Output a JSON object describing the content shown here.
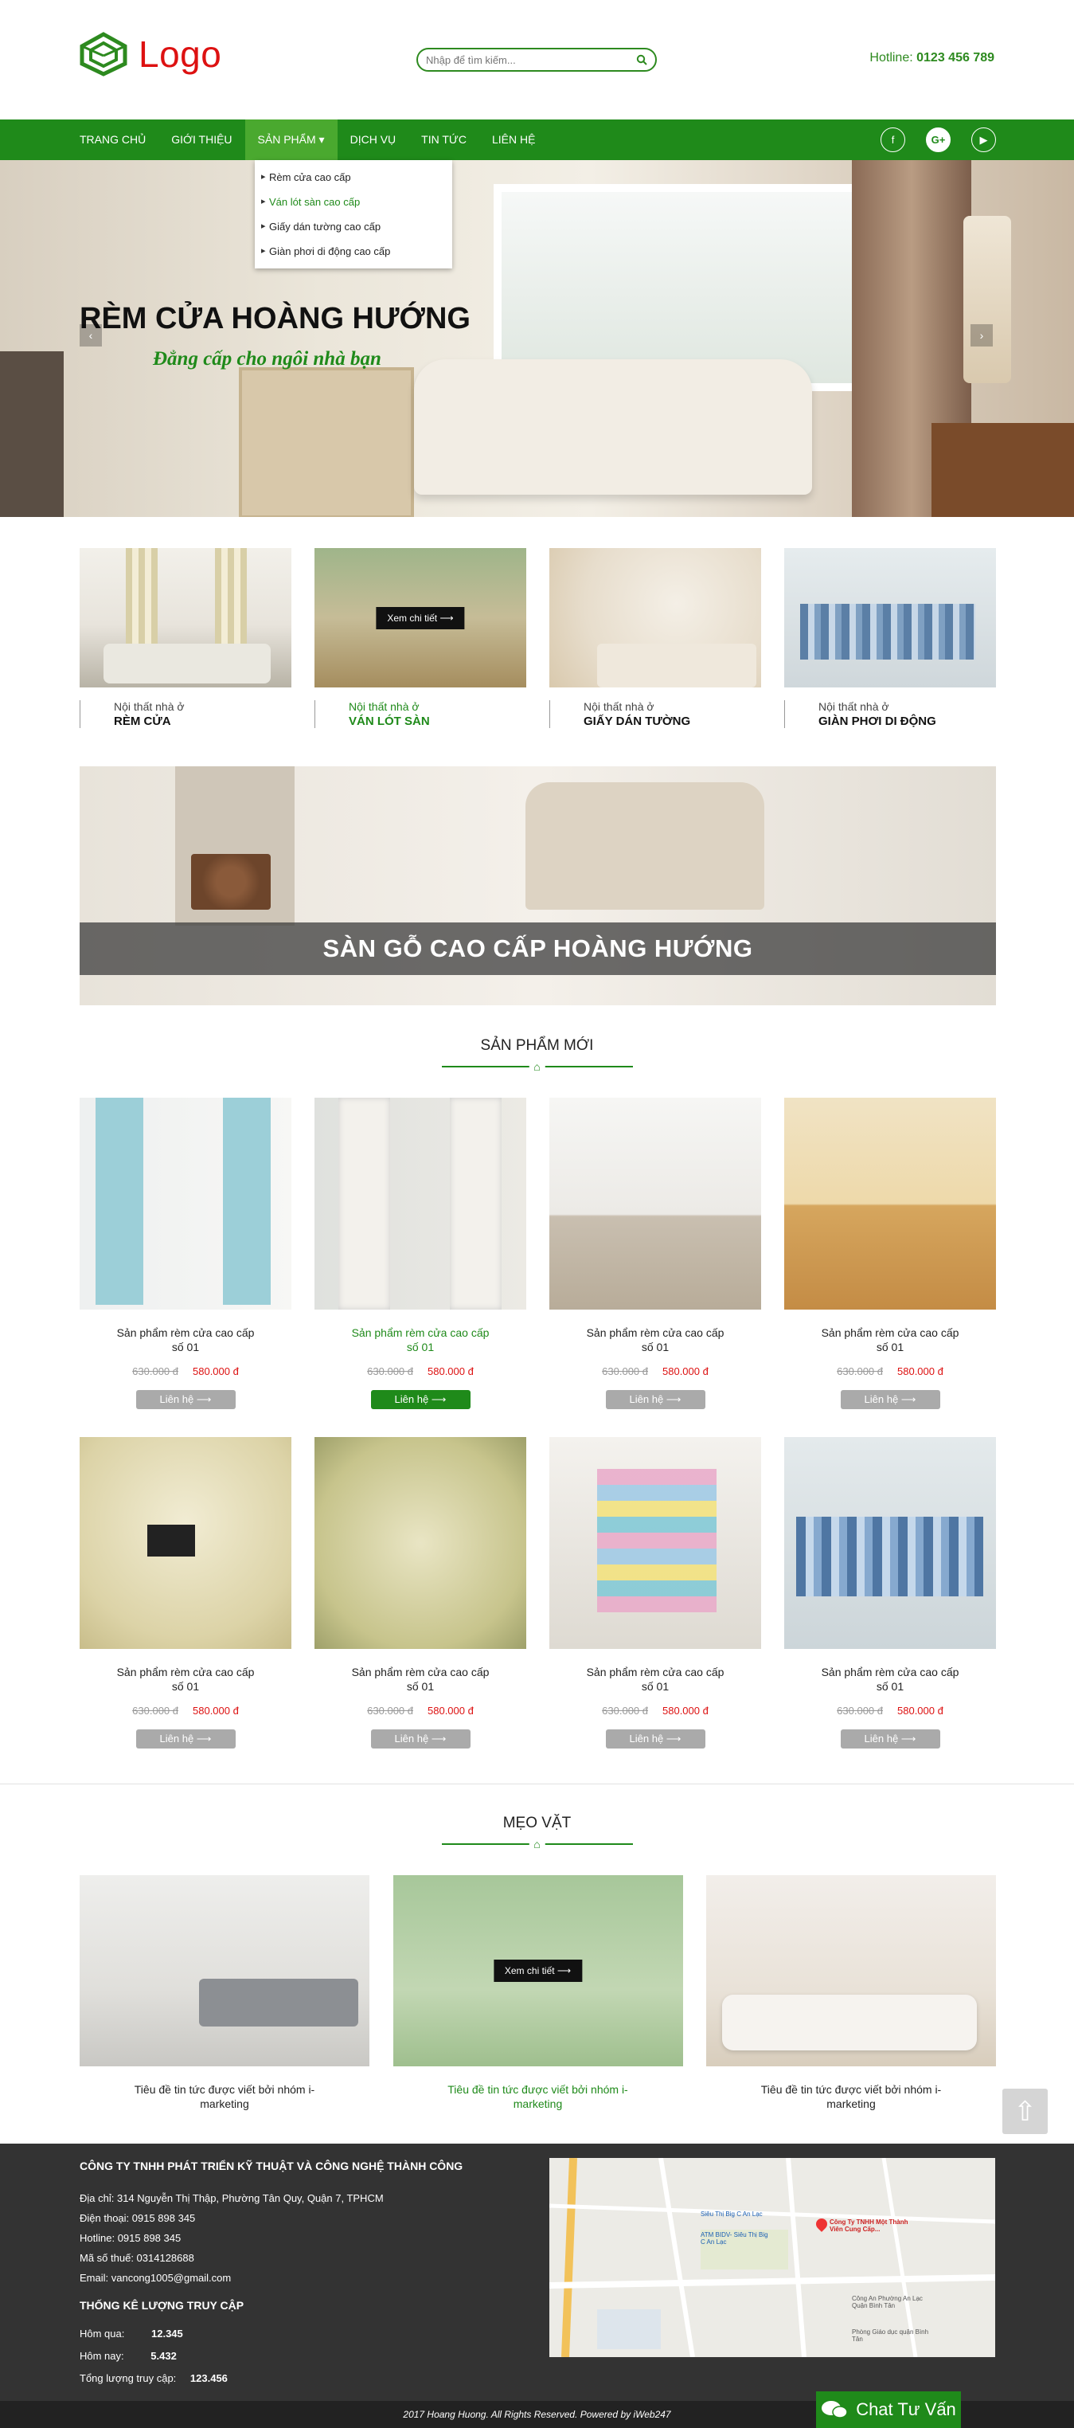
{
  "header": {
    "logo_text": "Logo",
    "search_placeholder": "Nhập để tìm kiếm...",
    "hotline_label": "Hotline:",
    "hotline_number": "0123 456 789"
  },
  "nav": {
    "items": [
      "TRANG CHỦ",
      "GIỚI THIỆU",
      "SẢN PHẨM ▾",
      "DỊCH VỤ",
      "TIN TỨC",
      "LIÊN HỆ"
    ],
    "socials": [
      "f",
      "G+",
      "▶"
    ],
    "dropdown": [
      "Rèm cửa cao cấp",
      "Ván lót sàn cao cấp",
      "Giấy dán tường cao cấp",
      "Giàn phơi di động cao cấp"
    ]
  },
  "slider": {
    "title": "RÈM CỬA HOÀNG HƯỚNG",
    "subtitle": "Đẳng cấp cho ngôi nhà bạn",
    "prev": "‹",
    "next": "›"
  },
  "categories": [
    {
      "small": "Nội thất nhà ở",
      "big": "RÈM CỬA"
    },
    {
      "small": "Nội thất nhà ở",
      "big": "VÁN LÓT SÀN",
      "overlay": "Xem chi tiết ⟶"
    },
    {
      "small": "Nội thất nhà ở",
      "big": "GIẤY DÁN TƯỜNG"
    },
    {
      "small": "Nội thất nhà ở",
      "big": "GIÀN PHƠI DI ĐỘNG"
    }
  ],
  "banner": {
    "title": "SÀN GỖ CAO CẤP HOÀNG HƯỚNG"
  },
  "new_products": {
    "title": "SẢN PHẨM MỚI",
    "row1": [
      {
        "name": "Sản phẩm rèm cửa cao cấp số 01",
        "old": "630.000 đ",
        "new": "580.000 đ",
        "btn": "Liên hệ ⟶"
      },
      {
        "name": "Sản phẩm rèm cửa cao cấp số 01",
        "old": "630.000 đ",
        "new": "580.000 đ",
        "btn": "Liên hệ ⟶"
      },
      {
        "name": "Sản phẩm rèm cửa cao cấp số 01",
        "old": "630.000 đ",
        "new": "580.000 đ",
        "btn": "Liên hệ ⟶"
      },
      {
        "name": "Sản phẩm rèm cửa cao cấp số 01",
        "old": "630.000 đ",
        "new": "580.000 đ",
        "btn": "Liên hệ ⟶"
      }
    ],
    "row2": [
      {
        "name": "Sản phẩm rèm cửa cao cấp số 01",
        "old": "630.000 đ",
        "new": "580.000 đ",
        "btn": "Liên hệ ⟶"
      },
      {
        "name": "Sản phẩm rèm cửa cao cấp số 01",
        "old": "630.000 đ",
        "new": "580.000 đ",
        "btn": "Liên hệ ⟶"
      },
      {
        "name": "Sản phẩm rèm cửa cao cấp số 01",
        "old": "630.000 đ",
        "new": "580.000 đ",
        "btn": "Liên hệ ⟶"
      },
      {
        "name": "Sản phẩm rèm cửa cao cấp số 01",
        "old": "630.000 đ",
        "new": "580.000 đ",
        "btn": "Liên hệ ⟶"
      }
    ]
  },
  "tips": {
    "title": "MẸO VẶT",
    "items": [
      {
        "title": "Tiêu đề tin tức được viết bởi nhóm i-marketing"
      },
      {
        "title": "Tiêu đề tin tức được viết bởi nhóm i-marketing",
        "overlay": "Xem chi tiết ⟶"
      },
      {
        "title": "Tiêu đề tin tức được viết bởi nhóm i-marketing"
      }
    ]
  },
  "footer": {
    "company": "CÔNG TY TNHH PHÁT TRIỂN KỸ THUẬT VÀ CÔNG NGHỆ THÀNH CÔNG",
    "address": "Địa chỉ: 314 Nguyễn Thị Thập, Phường Tân Quy, Quận 7, TPHCM",
    "phone": "Điện thoại: 0915 898 345",
    "hotline": "Hotline: 0915 898 345",
    "tax": "Mã số thuế: 0314128688",
    "email": "Email: vancong1005@gmail.com",
    "stats_title": "THỐNG KÊ LƯỢNG TRUY CẬP",
    "yesterday_label": "Hôm qua:",
    "yesterday": "12.345",
    "today_label": "Hôm nay:",
    "today": "5.432",
    "total_label": "Tổng lượng truy cập:",
    "total": "123.456",
    "copyright": "2017 Hoang Huong. All Rights Reserved. Powered by iWeb247",
    "map_labels": [
      "Siêu Thị Big C An Lạc",
      "ATM BIDV- Siêu Thị Big C An Lạc",
      "Công Ty TNHH Một Thành Viên Cung Cấp...",
      "Công An Phường An Lạc Quận Bình Tân",
      "Phòng Giáo dục quận Bình Tân"
    ]
  },
  "chat": {
    "label": "Chat Tư Vấn"
  },
  "scroll_top": "⇧",
  "colors": {
    "brand": "#1f8a1a",
    "price": "#dd1111",
    "logo": "#dd1111"
  }
}
